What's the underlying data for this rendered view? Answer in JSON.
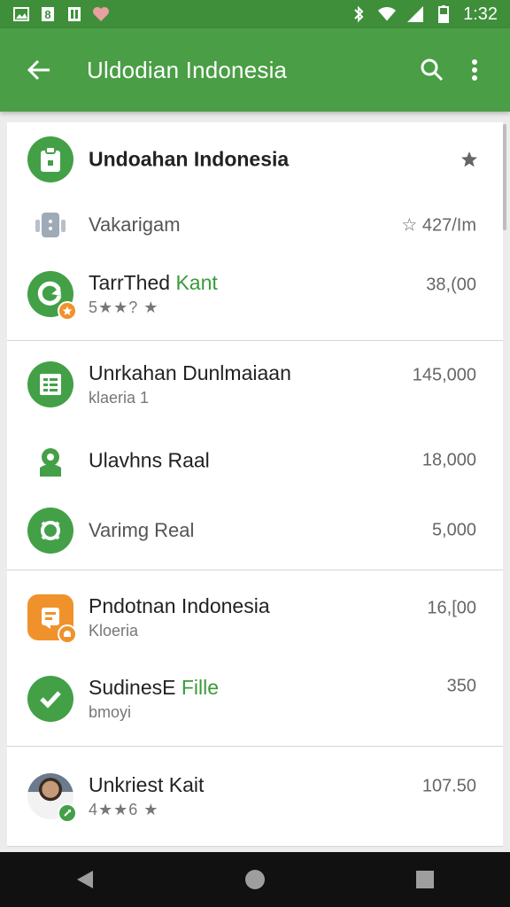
{
  "status_bar": {
    "time": "1:32"
  },
  "app_bar": {
    "title": "Uldodian Indonesia"
  },
  "colors": {
    "primary": "#4a9e45",
    "status": "#3f8f3a",
    "accent_text": "#3a9a3a",
    "orange": "#f0922b"
  },
  "sections": [
    {
      "rows": [
        {
          "name": "Undoahan Indonesia",
          "action": "star-icon"
        },
        {
          "name": "Vakarigam",
          "value": "☆ 427/Im"
        },
        {
          "name": "TarrThed ",
          "name_accent": "Kant",
          "subtitle": "5★★? ★",
          "value": "38,(00"
        }
      ]
    },
    {
      "rows": [
        {
          "name": "Unrkahan Dunlmaiaan",
          "subtitle": "klaeria  1",
          "value": "145,000"
        },
        {
          "name": "Ulavhns Raal",
          "value": "18,000"
        },
        {
          "name": "Varimg Real",
          "value": "5,000"
        }
      ]
    },
    {
      "rows": [
        {
          "name": "Pndotnan Indonesia",
          "subtitle": "Kloeria",
          "value": "16,[00"
        },
        {
          "name": "SudinesE ",
          "name_accent": "Fille",
          "subtitle": "bmoyi",
          "value": "350"
        }
      ]
    },
    {
      "rows": [
        {
          "name": "Unkriest Kait",
          "subtitle": "4★★6 ★",
          "value": "107.50"
        }
      ]
    }
  ]
}
